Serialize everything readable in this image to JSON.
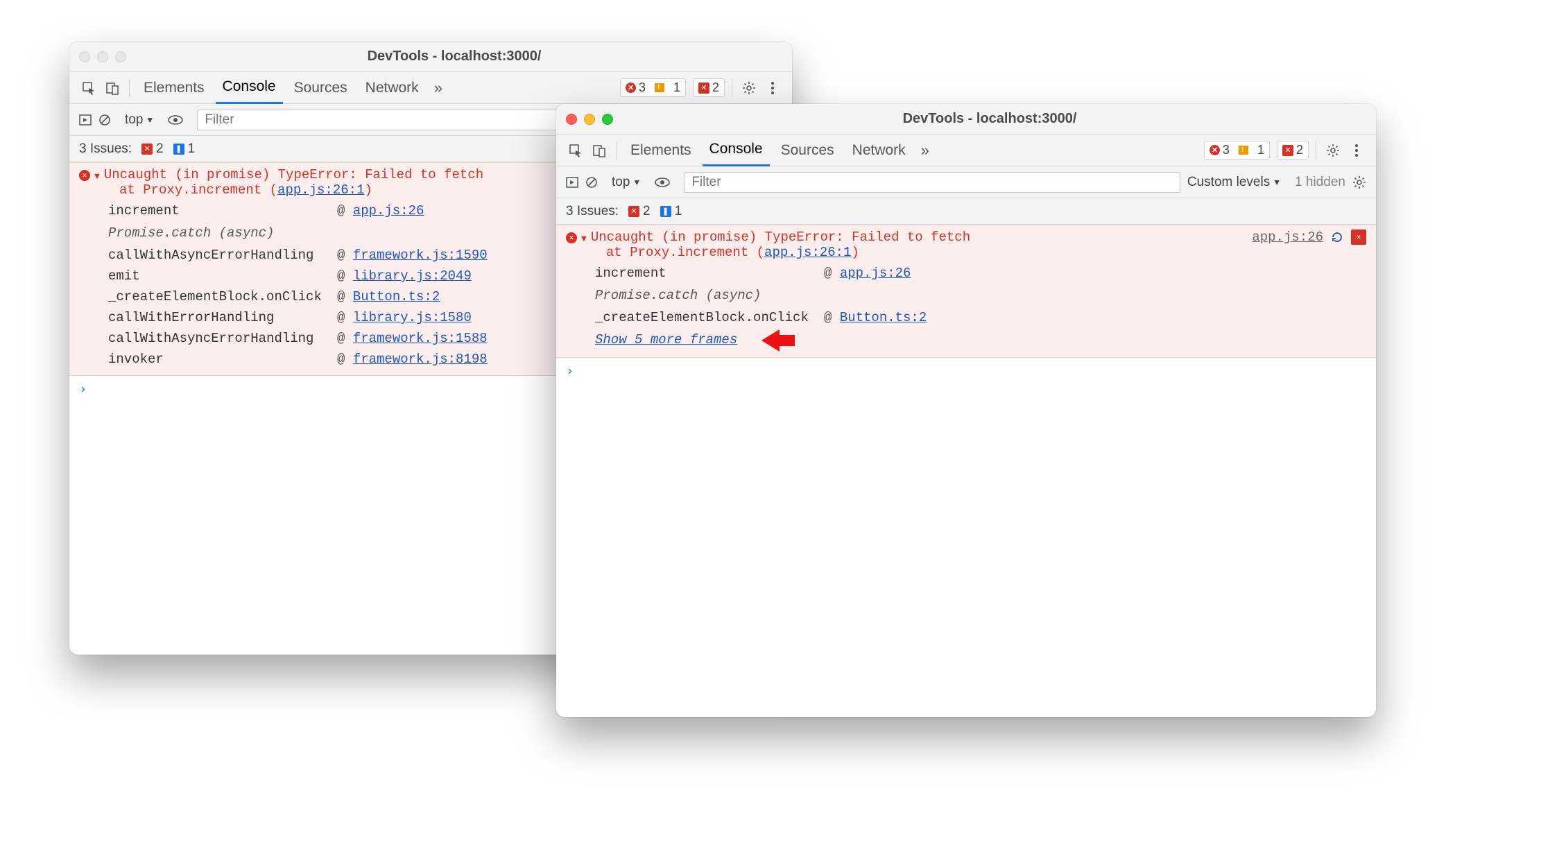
{
  "title": "DevTools - localhost:3000/",
  "tabs": {
    "elements": "Elements",
    "console": "Console",
    "sources": "Sources",
    "network": "Network"
  },
  "badges_left": {
    "errors": "3",
    "warnings": "1",
    "blocked": "2"
  },
  "console_toolbar": {
    "context": "top",
    "filter_placeholder": "Filter",
    "custom_levels": "Custom levels",
    "hidden": "1 hidden"
  },
  "issues": {
    "label": "3 Issues:",
    "red": "2",
    "blue": "1"
  },
  "error": {
    "headline": "Uncaught (in promise) TypeError: Failed to fetch",
    "at_prefix": "at Proxy.increment (",
    "at_link": "app.js:26:1",
    "at_suffix": ")",
    "source_link": "app.js:26"
  },
  "stack_full": [
    {
      "name": "increment",
      "link": "app.js:26"
    },
    {
      "async": "Promise.catch (async)"
    },
    {
      "name": "callWithAsyncErrorHandling",
      "link": "framework.js:1590"
    },
    {
      "name": "emit",
      "link": "library.js:2049"
    },
    {
      "name": "_createElementBlock.onClick",
      "link": "Button.ts:2"
    },
    {
      "name": "callWithErrorHandling",
      "link": "library.js:1580"
    },
    {
      "name": "callWithAsyncErrorHandling",
      "link": "framework.js:1588"
    },
    {
      "name": "invoker",
      "link": "framework.js:8198"
    }
  ],
  "stack_short": [
    {
      "name": "increment",
      "link": "app.js:26"
    },
    {
      "async": "Promise.catch (async)"
    },
    {
      "name": "_createElementBlock.onClick",
      "link": "Button.ts:2"
    }
  ],
  "show_more": "Show 5 more frames"
}
